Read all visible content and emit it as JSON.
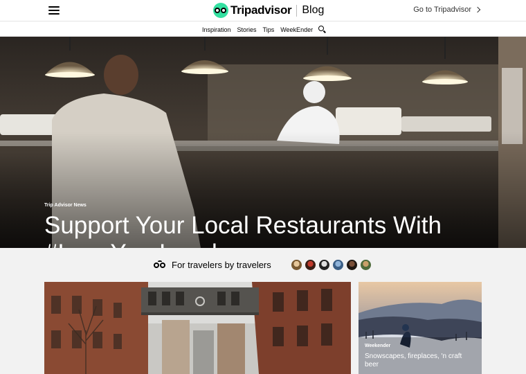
{
  "header": {
    "brand_name": "Tripadvisor",
    "section_name": "Blog",
    "goto_label": "Go to Tripadvisor"
  },
  "nav": {
    "links": [
      "Inspiration",
      "Stories",
      "Tips",
      "WeekEnder"
    ]
  },
  "hero": {
    "category": "Trip Advisor News",
    "title": "Support Your Local Restaurants With #LoveYourLocal",
    "slide_count": 5,
    "active_slide": 3
  },
  "tagline": {
    "text": "For travelers by travelers"
  },
  "cards": {
    "side": {
      "category": "Weekender",
      "title": "Snowscapes, fireplaces, 'n craft beer"
    }
  },
  "colors": {
    "brand_green": "#34e0a1",
    "dot_active": "#ffffff",
    "dot_inactive": "#9a9a9a"
  }
}
